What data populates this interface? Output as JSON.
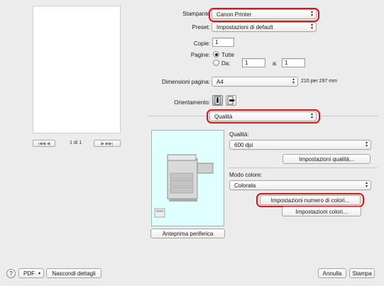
{
  "preview": {
    "page_label": "1 di 1"
  },
  "printer": {
    "label": "Stampante",
    "value": "Canon Printer"
  },
  "preset": {
    "label": "Preset:",
    "value": "Impostazioni di default"
  },
  "copies": {
    "label": "Copie:",
    "value": "1"
  },
  "pages": {
    "label": "Pagine:",
    "all_label": "Tutte",
    "from_label": "Da:",
    "from_value": "1",
    "to_label": "a:",
    "to_value": "1"
  },
  "paper_size": {
    "label": "Dimensioni pagina:",
    "value": "A4",
    "dims": "210 per 297 mm"
  },
  "orientation": {
    "label": "Orientamento:"
  },
  "panel_select": {
    "value": "Qualità"
  },
  "quality": {
    "label": "Qualità:",
    "value": "600 dpi",
    "settings_button": "Impostazioni qualità..."
  },
  "color_mode": {
    "label": "Modo colore:",
    "value": "Colorata",
    "num_colors_button": "Impostazioni numero di colori...",
    "color_settings_button": "Impostazioni colori..."
  },
  "device_preview_button": "Anteprima periferica",
  "footer": {
    "help": "?",
    "pdf_label": "PDF",
    "hide_details": "Nascondi dettagli",
    "cancel": "Annulla",
    "print": "Stampa"
  },
  "colors": {
    "highlight": "#d8161c",
    "device_bg": "#e0ffff"
  }
}
